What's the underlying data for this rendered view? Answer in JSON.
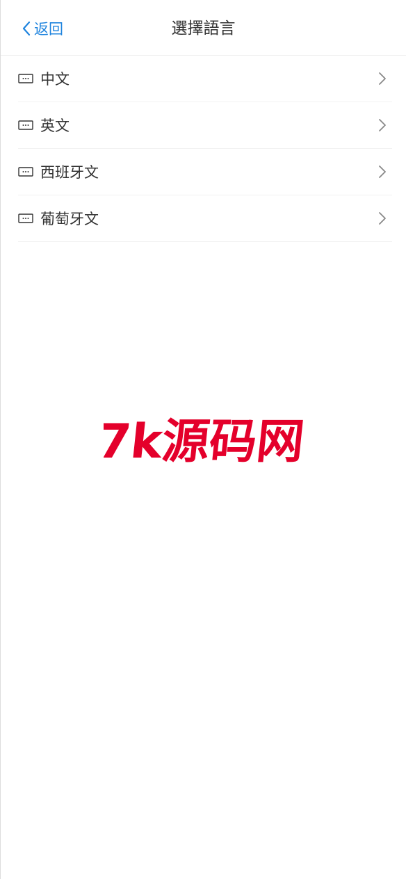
{
  "navbar": {
    "back_label": "返回",
    "title": "選擇語言"
  },
  "languages": [
    {
      "label": "中文",
      "icon": "keyboard-icon"
    },
    {
      "label": "英文",
      "icon": "keyboard-icon"
    },
    {
      "label": "西班牙文",
      "icon": "keyboard-icon"
    },
    {
      "label": "葡萄牙文",
      "icon": "keyboard-icon"
    }
  ],
  "watermark": {
    "text": "7k源码网",
    "color": "#e4002b"
  },
  "colors": {
    "accent": "#1f84de",
    "text": "#333333",
    "chevron": "#888888"
  }
}
